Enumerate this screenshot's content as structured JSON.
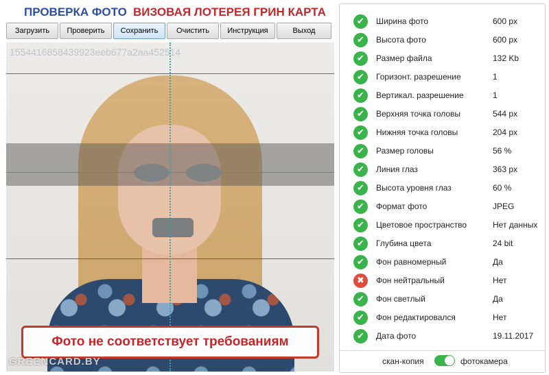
{
  "header": {
    "title_left": "ПРОВЕРКА ФОТО",
    "title_right": "ВИЗОВАЯ ЛОТЕРЕЯ ГРИН КАРТА"
  },
  "toolbar": {
    "buttons": [
      "Загрузить",
      "Проверить",
      "Сохранить",
      "Очистить",
      "Инструкция",
      "Выход"
    ]
  },
  "photo": {
    "file_id": "1554416858439923eeb677a2aa452514",
    "warning": "Фото не соответствует требованиям",
    "watermark": "GREENCARD.BY"
  },
  "results": [
    {
      "status": "ok",
      "label": "Ширина фото",
      "value": "600 px"
    },
    {
      "status": "ok",
      "label": "Высота фото",
      "value": "600 px"
    },
    {
      "status": "ok",
      "label": "Размер файла",
      "value": "132 Kb"
    },
    {
      "status": "ok",
      "label": "Горизонт. разрешение",
      "value": "1"
    },
    {
      "status": "ok",
      "label": "Вертикал. разрешение",
      "value": "1"
    },
    {
      "status": "ok",
      "label": "Верхняя точка головы",
      "value": "544 px"
    },
    {
      "status": "ok",
      "label": "Нижняя точка головы",
      "value": "204 px"
    },
    {
      "status": "ok",
      "label": "Размер головы",
      "value": "56 %"
    },
    {
      "status": "ok",
      "label": "Линия глаз",
      "value": "363 px"
    },
    {
      "status": "ok",
      "label": "Высота уровня глаз",
      "value": "60 %"
    },
    {
      "status": "ok",
      "label": "Формат фото",
      "value": "JPEG"
    },
    {
      "status": "ok",
      "label": "Цветовое пространство",
      "value": "Нет данных"
    },
    {
      "status": "ok",
      "label": "Глубина цвета",
      "value": "24 bit"
    },
    {
      "status": "ok",
      "label": "Фон равномерный",
      "value": "Да"
    },
    {
      "status": "err",
      "label": "Фон нейтральный",
      "value": "Нет"
    },
    {
      "status": "ok",
      "label": "Фон светлый",
      "value": "Да"
    },
    {
      "status": "ok",
      "label": "Фон редактировался",
      "value": "Нет"
    },
    {
      "status": "ok",
      "label": "Дата фото",
      "value": "19.11.2017"
    }
  ],
  "mode": {
    "left_label": "скан-копия",
    "right_label": "фотокамера",
    "toggle_on": true
  },
  "colors": {
    "ok": "#39b44a",
    "error": "#e04c3c",
    "title_blue": "#2a4ea8",
    "title_red": "#c4262a"
  },
  "icons": {
    "ok": "check-circle-icon",
    "err": "x-circle-icon"
  }
}
